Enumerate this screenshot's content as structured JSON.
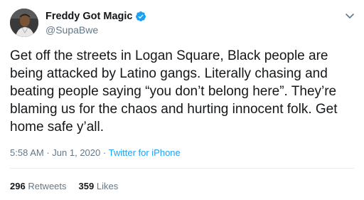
{
  "author": {
    "display_name": "Freddy Got Magic",
    "handle": "@SupaBwe",
    "verified": true
  },
  "tweet": {
    "text": "Get off the streets in Logan Square, Black people are being attacked by Latino gangs. Literally chasing and beating people saying “you don’t belong here”. They’re blaming us for the chaos and hurting innocent folk. Get home safe y’all.",
    "time": "5:58 AM",
    "date": "Jun 1, 2020",
    "separator": "·",
    "source": "Twitter for iPhone"
  },
  "stats": {
    "retweets_count": "296",
    "retweets_label": "Retweets",
    "likes_count": "359",
    "likes_label": "Likes"
  },
  "icons": {
    "verified": "verified-badge-icon",
    "menu": "chevron-down-icon",
    "avatar": "user-avatar"
  },
  "colors": {
    "link": "#1da1f2",
    "muted": "#657786",
    "text": "#14171a",
    "verified": "#1da1f2"
  }
}
